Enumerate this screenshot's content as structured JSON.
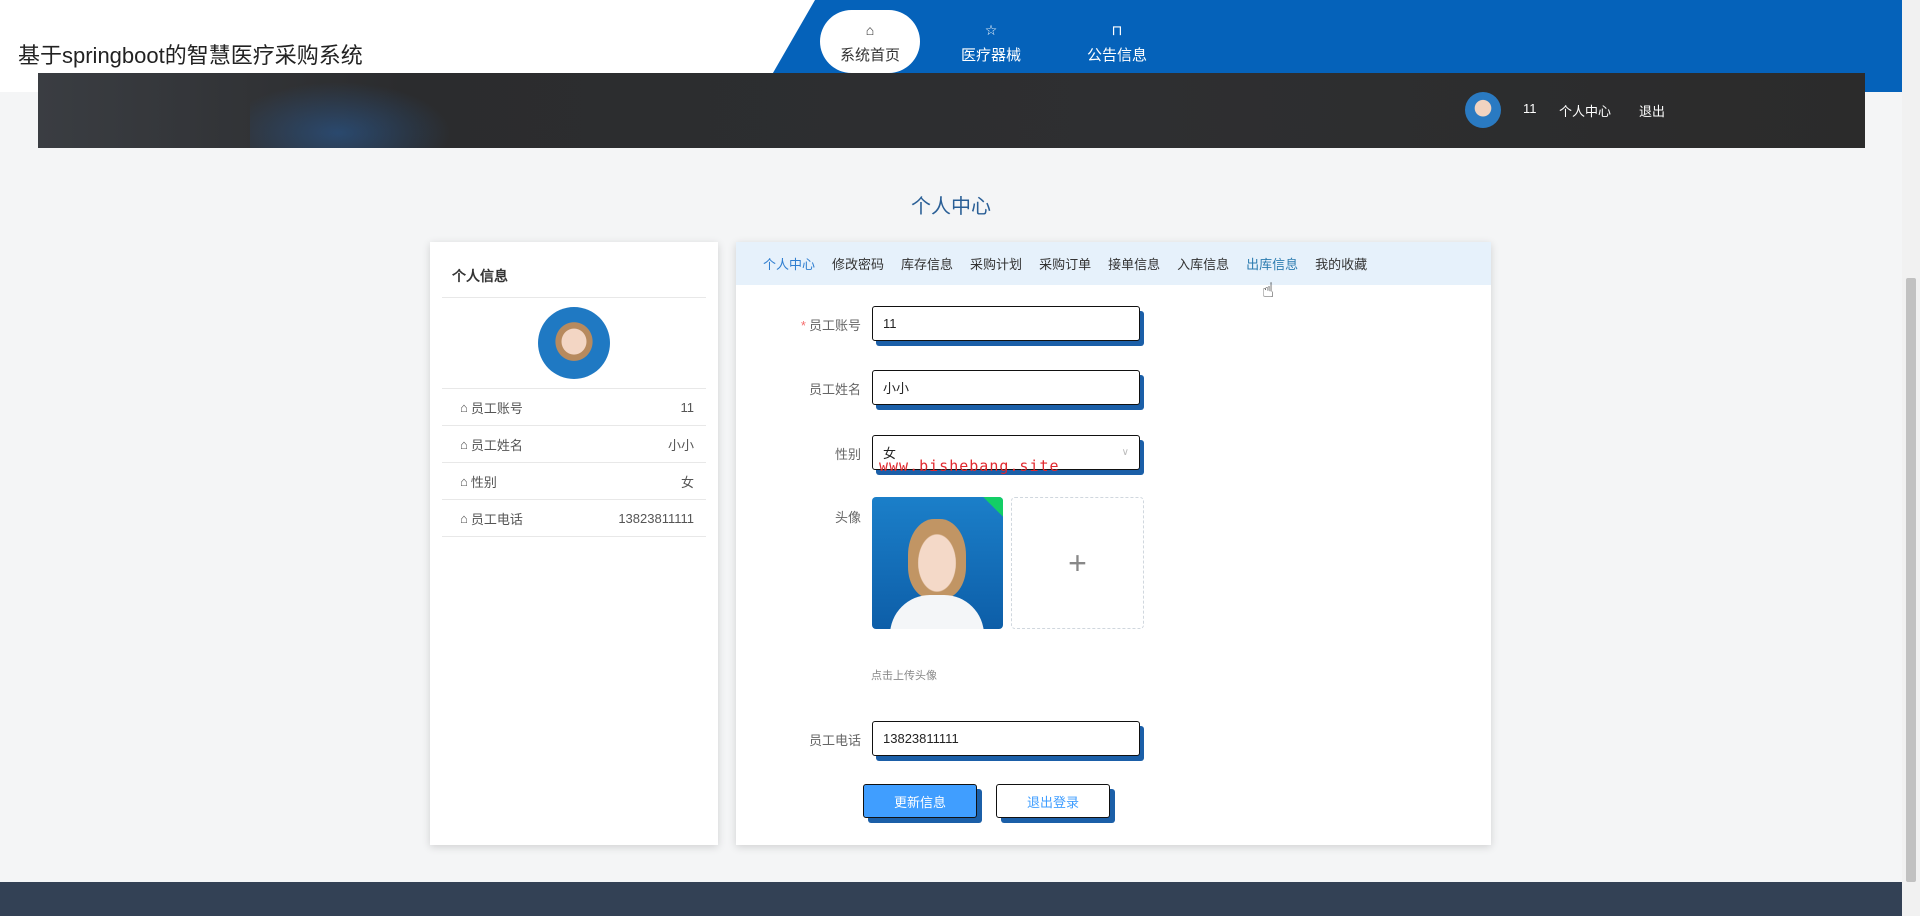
{
  "header": {
    "title": "基于springboot的智慧医疗采购系统",
    "nav": [
      {
        "label": "系统首页",
        "icon": "home-icon"
      },
      {
        "label": "医疗器械",
        "icon": "star-icon"
      },
      {
        "label": "公告信息",
        "icon": "bag-icon"
      }
    ],
    "user": {
      "name": "11",
      "center": "个人中心",
      "logout": "退出"
    }
  },
  "page_title": "个人中心",
  "left": {
    "title": "个人信息",
    "rows": [
      {
        "k": "员工账号",
        "v": "11"
      },
      {
        "k": "员工姓名",
        "v": "小小"
      },
      {
        "k": "性别",
        "v": "女"
      },
      {
        "k": "员工电话",
        "v": "13823811111"
      }
    ]
  },
  "tabs": [
    "个人中心",
    "修改密码",
    "库存信息",
    "采购计划",
    "采购订单",
    "接单信息",
    "入库信息",
    "出库信息",
    "我的收藏"
  ],
  "form": {
    "account_label": "员工账号",
    "account": "11",
    "name_label": "员工姓名",
    "name": "小小",
    "gender_label": "性别",
    "gender": "女",
    "avatar_label": "头像",
    "upload_hint": "点击上传头像",
    "phone_label": "员工电话",
    "phone": "13823811111",
    "update": "更新信息",
    "logout": "退出登录"
  },
  "watermark": "www.bishebang.site",
  "colors": {
    "accent": "#0562ba",
    "primary_button": "#409eff",
    "footer": "#334155"
  }
}
